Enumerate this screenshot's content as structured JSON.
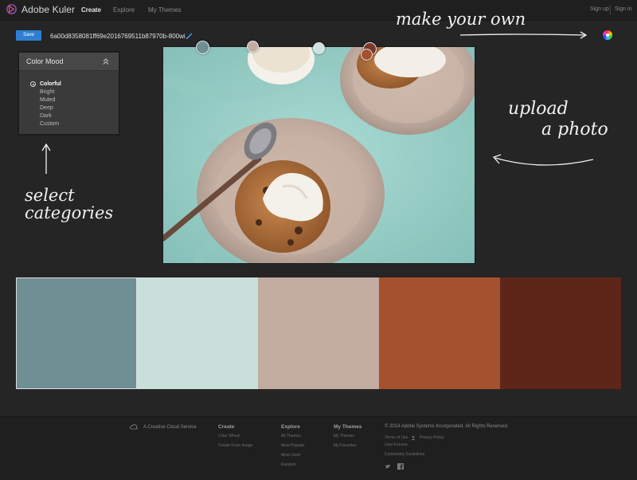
{
  "app": {
    "name": "Adobe Kuler",
    "nav": [
      "Create",
      "Explore",
      "My Themes"
    ],
    "auth": [
      "Sign up",
      "Sign in"
    ]
  },
  "toolbar": {
    "save_label": "Save",
    "theme_name": "6a00d8358081ff69e2016769511b87970b-800wi"
  },
  "color_mood": {
    "title": "Color Mood",
    "options": [
      "Colorful",
      "Bright",
      "Muted",
      "Deep",
      "Dark",
      "Custom"
    ],
    "selected": "Colorful"
  },
  "pickers": [
    {
      "color": "#6e8f93"
    },
    {
      "color": "#c2aca0"
    },
    {
      "color": "#cce3df"
    },
    {
      "color": "#7a3a2a"
    },
    {
      "color": "#a5512e"
    }
  ],
  "swatches": [
    "#6e8f93",
    "#c9e0da",
    "#c2aca0",
    "#a5512e",
    "#5e2618"
  ],
  "annotations": {
    "make_your_own": "make your own",
    "upload_line1": "upload",
    "upload_line2": "a photo",
    "select_line1": "select",
    "select_line2": "categories"
  },
  "footer": {
    "cc": "A Creative Cloud Service",
    "create": {
      "title": "Create",
      "links": [
        "Color Wheel",
        "Create From Image"
      ]
    },
    "explore": {
      "title": "Explore",
      "links": [
        "All Themes",
        "Most Popular",
        "Most Used",
        "Random"
      ]
    },
    "mythemes": {
      "title": "My Themes",
      "links": [
        "My Themes",
        "My Favorites"
      ]
    },
    "copyright": "© 2014 Adobe Systems Incorporated. All Rights Reserved.",
    "terms": "Terms of Use",
    "privacy": "Privacy Policy",
    "forums": "User Forums",
    "guidelines": "Community Guidelines"
  }
}
